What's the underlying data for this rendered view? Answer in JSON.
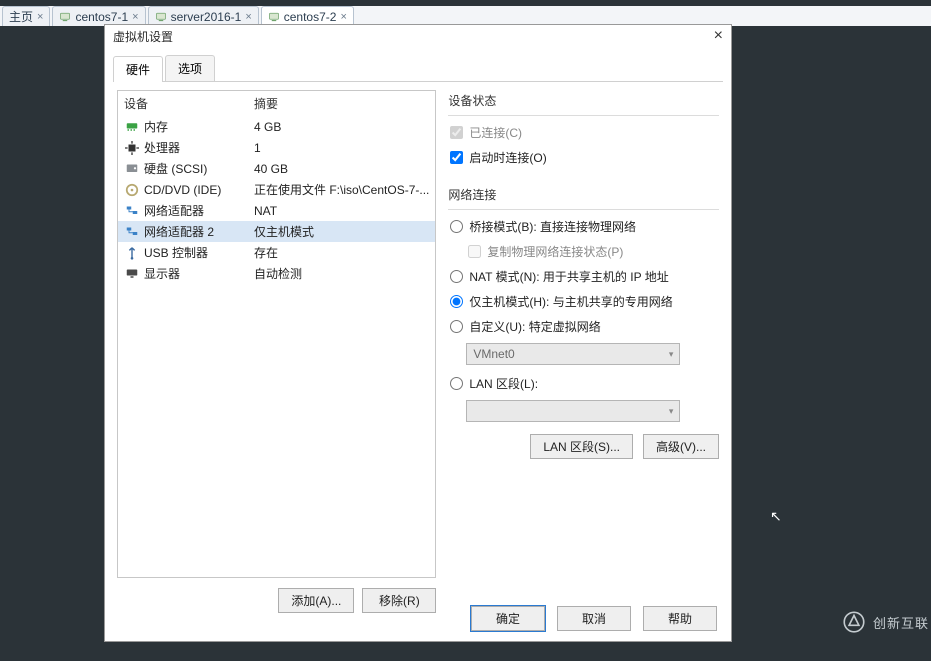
{
  "tabs": {
    "items": [
      {
        "label": "主页",
        "active": false
      },
      {
        "label": "centos7-1",
        "active": false
      },
      {
        "label": "server2016-1",
        "active": false
      },
      {
        "label": "centos7-2",
        "active": true
      }
    ]
  },
  "dialog": {
    "title": "虚拟机设置",
    "tabs": {
      "hardware": "硬件",
      "options": "选项"
    },
    "headers": {
      "device": "设备",
      "summary": "摘要"
    },
    "hardware": [
      {
        "icon": "memory-icon",
        "icon_color": "#3aa244",
        "name": "内存",
        "summary": "4 GB",
        "selected": false
      },
      {
        "icon": "cpu-icon",
        "icon_color": "#333333",
        "name": "处理器",
        "summary": "1",
        "selected": false
      },
      {
        "icon": "disk-icon",
        "icon_color": "#8a8f94",
        "name": "硬盘 (SCSI)",
        "summary": "40 GB",
        "selected": false
      },
      {
        "icon": "cd-icon",
        "icon_color": "#b7a870",
        "name": "CD/DVD (IDE)",
        "summary": "正在使用文件 F:\\iso\\CentOS-7-...",
        "selected": false
      },
      {
        "icon": "network-icon",
        "icon_color": "#3b82c7",
        "name": "网络适配器",
        "summary": "NAT",
        "selected": false
      },
      {
        "icon": "network-icon",
        "icon_color": "#3b82c7",
        "name": "网络适配器 2",
        "summary": "仅主机模式",
        "selected": true
      },
      {
        "icon": "usb-icon",
        "icon_color": "#3a6aa0",
        "name": "USB 控制器",
        "summary": "存在",
        "selected": false
      },
      {
        "icon": "display-icon",
        "icon_color": "#4a4a4a",
        "name": "显示器",
        "summary": "自动检测",
        "selected": false
      }
    ],
    "buttons": {
      "add": "添加(A)...",
      "remove": "移除(R)"
    },
    "right": {
      "devstate": {
        "title": "设备状态",
        "connected": {
          "label": "已连接(C)",
          "checked": true,
          "disabled": true
        },
        "connect_at_power": {
          "label": "启动时连接(O)",
          "checked": true,
          "disabled": false
        }
      },
      "netconn": {
        "title": "网络连接",
        "bridged": {
          "label": "桥接模式(B): 直接连接物理网络"
        },
        "replicate": {
          "label": "复制物理网络连接状态(P)"
        },
        "nat": {
          "label": "NAT 模式(N): 用于共享主机的 IP 地址"
        },
        "hostonly": {
          "label": "仅主机模式(H): 与主机共享的专用网络"
        },
        "custom": {
          "label": "自定义(U): 特定虚拟网络",
          "select": "VMnet0"
        },
        "lanseg": {
          "label": "LAN 区段(L):",
          "select": ""
        },
        "selected": "hostonly"
      },
      "adv": {
        "lan": "LAN 区段(S)...",
        "advanced": "高级(V)..."
      }
    },
    "footer": {
      "ok": "确定",
      "cancel": "取消",
      "help": "帮助"
    }
  },
  "watermark": {
    "text": "创新互联"
  }
}
